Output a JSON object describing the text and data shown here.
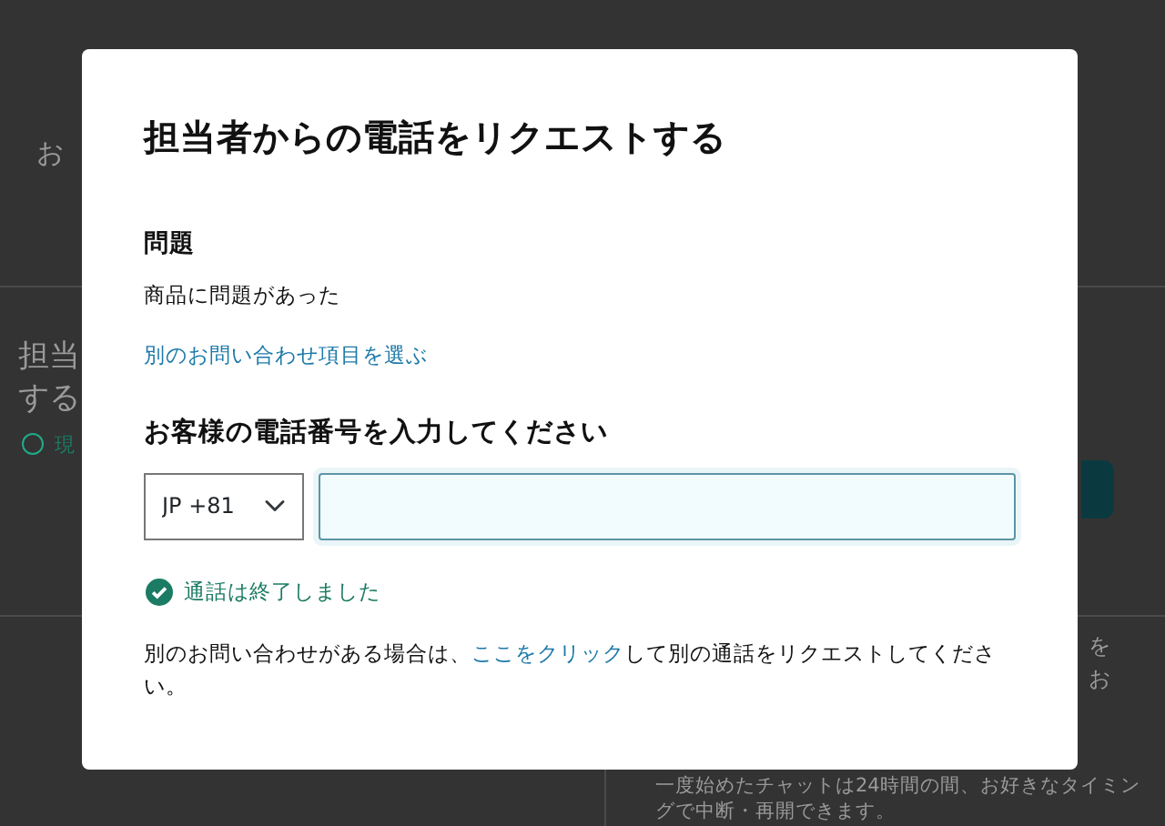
{
  "background": {
    "texts": [
      {
        "kind": "label",
        "text": "お"
      },
      {
        "kind": "heading",
        "text": "担当"
      },
      {
        "kind": "heading",
        "text": "する"
      },
      {
        "kind": "note",
        "text": "現"
      },
      {
        "kind": "side",
        "text": "を"
      },
      {
        "kind": "side",
        "text": "お"
      },
      {
        "kind": "info",
        "text": "一度始めたチャットは24時間の間、お好きなタイミングで中断・再開できます。"
      }
    ]
  },
  "dialog": {
    "title": "担当者からの電話をリクエストする",
    "issue": {
      "heading": "問題",
      "value": "商品に問題があった",
      "link": "別のお問い合わせ項目を選ぶ"
    },
    "phone": {
      "heading": "お客様の電話番号を入力してください",
      "country": "JP +81",
      "focused": true
    },
    "status": {
      "kind": "success",
      "text": "通話は終了しました"
    },
    "footer": {
      "before": "別のお問い合わせがある場合は、",
      "link": "ここをクリック",
      "after": "して別の通話をリクエストしてください。"
    }
  }
}
